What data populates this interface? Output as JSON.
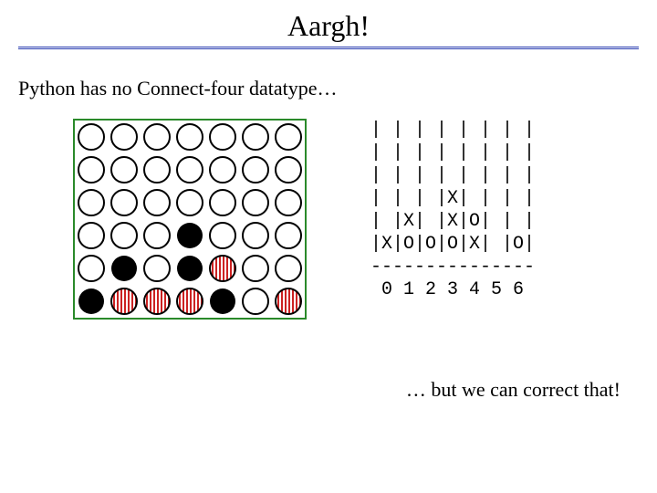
{
  "title": "Aargh!",
  "subtitle": "Python has no Connect-four datatype…",
  "footer": "… but we can correct that!",
  "board": {
    "cols": 7,
    "rows": 6,
    "legend": {
      "E": "empty-circle",
      "B": "black-piece",
      "R": "red-stripe-piece"
    },
    "grid": [
      [
        "E",
        "E",
        "E",
        "E",
        "E",
        "E",
        "E"
      ],
      [
        "E",
        "E",
        "E",
        "E",
        "E",
        "E",
        "E"
      ],
      [
        "E",
        "E",
        "E",
        "E",
        "E",
        "E",
        "E"
      ],
      [
        "E",
        "E",
        "E",
        "B",
        "E",
        "E",
        "E"
      ],
      [
        "E",
        "B",
        "E",
        "B",
        "R",
        "E",
        "E"
      ],
      [
        "B",
        "R",
        "R",
        "R",
        "B",
        "E",
        "R"
      ]
    ]
  },
  "ascii": {
    "lines": [
      "| | | | | | | |",
      "| | | | | | | |",
      "| | | | | | | |",
      "| | | |X| | | |",
      "| |X| |X|O| | |",
      "|X|O|O|O|X| |O|",
      "---------------",
      " 0 1 2 3 4 5 6"
    ]
  }
}
